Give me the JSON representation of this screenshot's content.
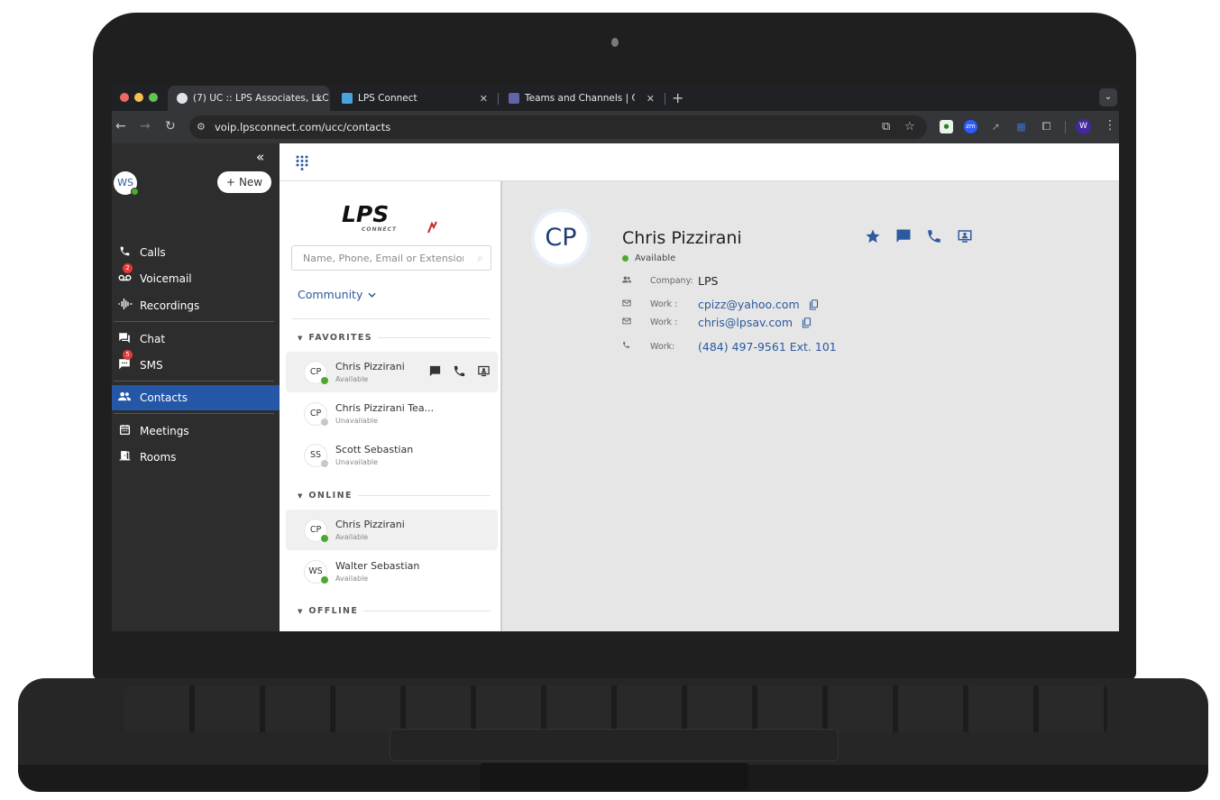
{
  "browser": {
    "tabs": [
      {
        "title": "(7) UC :: LPS Associates, LLC",
        "active": true,
        "favicon": "lps-uc-favicon"
      },
      {
        "title": "LPS Connect",
        "active": false,
        "favicon": "lps-connect-favicon"
      },
      {
        "title": "Teams and Channels | Custon",
        "active": false,
        "favicon": "teams-favicon"
      }
    ],
    "close_glyph": "✕",
    "new_tab_glyph": "+",
    "tab_search_glyph": "⌄",
    "url": "voip.lpsconnect.com/ucc/contacts",
    "profile_initial": "W",
    "extensions": [
      "evernote-extension",
      "zoom-extension",
      "arrow-extension",
      "dialpad-extension",
      "extensions-puzzle"
    ],
    "zoom_ext_label": "zm"
  },
  "sidebar": {
    "collapse_glyph": "«",
    "user_initials": "WS",
    "user_status": "available",
    "new_button": "New",
    "items": [
      {
        "label": "Calls",
        "icon": "phone-icon"
      },
      {
        "label": "Voicemail",
        "icon": "voicemail-icon",
        "badge": "2"
      },
      {
        "label": "Recordings",
        "icon": "waveform-icon"
      },
      {
        "label": "Chat",
        "icon": "chat-icon"
      },
      {
        "label": "SMS",
        "icon": "sms-icon",
        "badge": "5"
      },
      {
        "label": "Contacts",
        "icon": "contacts-icon",
        "active": true
      },
      {
        "label": "Meetings",
        "icon": "calendar-icon"
      },
      {
        "label": "Rooms",
        "icon": "door-icon"
      }
    ]
  },
  "contacts_panel": {
    "logo_text": "LPS",
    "logo_sub": "CONNECT",
    "search_placeholder": "Name, Phone, Email or Extension",
    "filter_label": "Community",
    "sections": {
      "favorites": "FAVORITES",
      "online": "ONLINE",
      "offline": "OFFLINE"
    },
    "favorites": [
      {
        "initials": "CP",
        "name": "Chris Pizzirani",
        "status": "Available",
        "online": true
      },
      {
        "initials": "CP",
        "name": "Chris Pizzirani Tea...",
        "status": "Unavailable",
        "online": false
      },
      {
        "initials": "SS",
        "name": "Scott Sebastian",
        "status": "Unavailable",
        "online": false
      }
    ],
    "online": [
      {
        "initials": "CP",
        "name": "Chris Pizzirani",
        "status": "Available",
        "online": true
      },
      {
        "initials": "WS",
        "name": "Walter Sebastian",
        "status": "Available",
        "online": true
      }
    ]
  },
  "detail": {
    "initials": "CP",
    "name": "Chris Pizzirani",
    "status": "Available",
    "fields": [
      {
        "icon": "company-icon",
        "label": "Company:",
        "value": "LPS"
      },
      {
        "icon": "email-icon",
        "label": "Work :",
        "value": "cpizz@yahoo.com"
      },
      {
        "icon": "email-icon",
        "label": "Work :",
        "value": "chris@lpsav.com"
      },
      {
        "icon": "phone-icon",
        "label": "Work:",
        "value": "(484) 497-9561 Ext. 101"
      }
    ]
  },
  "colors": {
    "accent": "#2c5aa0",
    "active_nav": "#2557a7",
    "available": "#4ea82f",
    "unavailable": "#c8c8c8",
    "badge": "#e53935"
  }
}
